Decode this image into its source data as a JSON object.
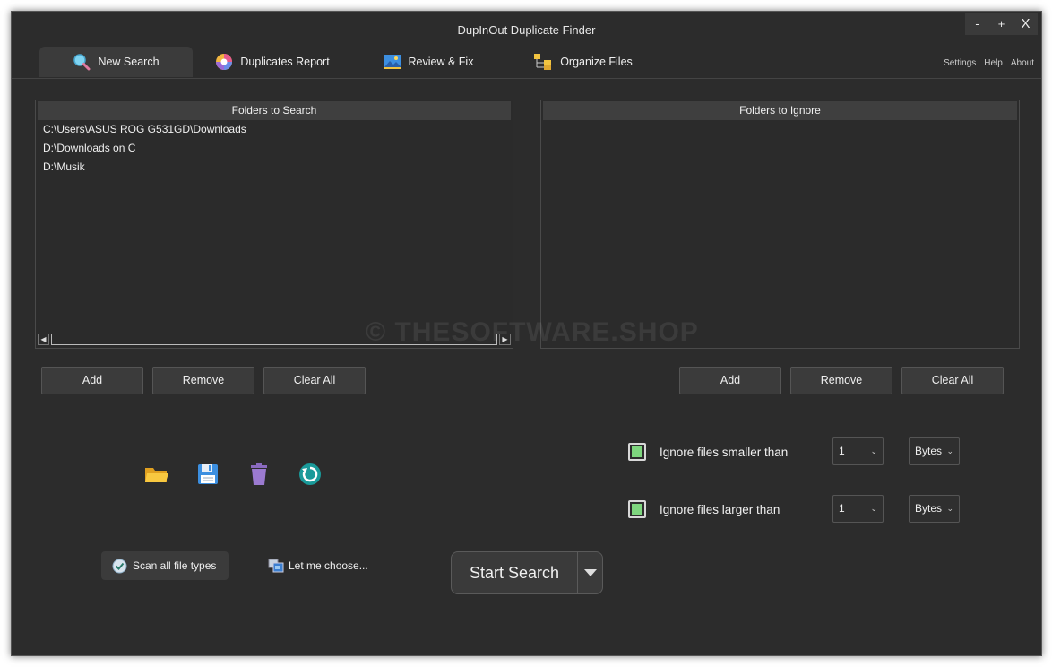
{
  "window": {
    "title": "DupInOut Duplicate Finder",
    "minimize": "-",
    "maximize": "+",
    "close": "X"
  },
  "tabs": [
    {
      "label": "New Search",
      "icon": "search-icon"
    },
    {
      "label": "Duplicates Report",
      "icon": "pie-chart-icon"
    },
    {
      "label": "Review & Fix",
      "icon": "image-icon"
    },
    {
      "label": "Organize Files",
      "icon": "folder-tree-icon"
    }
  ],
  "toplinks": {
    "settings": "Settings",
    "help": "Help",
    "about": "About"
  },
  "search_panel": {
    "header": "Folders to Search",
    "items": [
      "C:\\Users\\ASUS ROG G531GD\\Downloads",
      "D:\\Downloads on C",
      "D:\\Musik"
    ],
    "buttons": {
      "add": "Add",
      "remove": "Remove",
      "clear": "Clear All"
    }
  },
  "ignore_panel": {
    "header": "Folders to Ignore",
    "items": [],
    "buttons": {
      "add": "Add",
      "remove": "Remove",
      "clear": "Clear All"
    }
  },
  "tools": [
    "open-folder-icon",
    "save-icon",
    "trash-icon",
    "refresh-icon"
  ],
  "options": {
    "smaller": {
      "label": "Ignore files smaller than",
      "value": "1",
      "unit": "Bytes",
      "checked": true
    },
    "larger": {
      "label": "Ignore files larger than",
      "value": "1",
      "unit": "Bytes",
      "checked": true
    }
  },
  "scan": {
    "all_types": "Scan all file types",
    "choose": "Let me choose..."
  },
  "start": {
    "label": "Start Search"
  },
  "watermark": "© THESOFTWARE.SHOP",
  "colors": {
    "background": "#2c2c2c",
    "accent_check": "#7ed67e",
    "header": "#3f3f3f"
  }
}
